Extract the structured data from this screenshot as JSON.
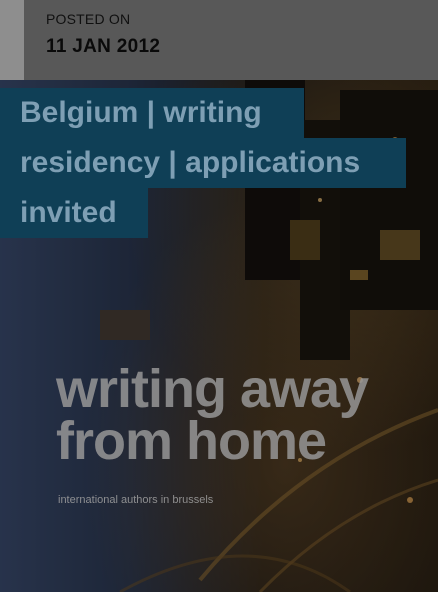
{
  "post": {
    "posted_label": "POSTED ON",
    "date": "11 JAN 2012",
    "title_lines": [
      "Belgium | writing",
      "residency | applications",
      "invited"
    ]
  },
  "cover": {
    "title_line1": "writing away",
    "title_line2": "from home",
    "subtitle": "international authors in brussels"
  },
  "colors": {
    "title_background": "#0f3f56",
    "title_text": "#7e9fb4"
  }
}
